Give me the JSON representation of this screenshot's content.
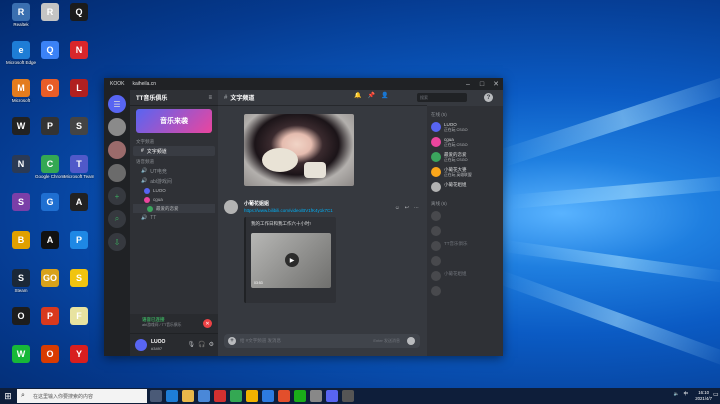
{
  "desktop": {
    "icons": [
      {
        "label": "Realtek",
        "col": 0,
        "row": 0,
        "color": "#3a6fb0",
        "glyph": "R"
      },
      {
        "label": "Microsoft Edge",
        "col": 0,
        "row": 1,
        "color": "#1e7dd6",
        "glyph": "e"
      },
      {
        "label": "Microsoft",
        "col": 0,
        "row": 2,
        "color": "#e37c1e",
        "glyph": "M"
      },
      {
        "label": "",
        "col": 0,
        "row": 3,
        "color": "#222",
        "glyph": "W"
      },
      {
        "label": "",
        "col": 0,
        "row": 4,
        "color": "#2b3a55",
        "glyph": "N"
      },
      {
        "label": "",
        "col": 0,
        "row": 5,
        "color": "#7a3fa8",
        "glyph": "S"
      },
      {
        "label": "",
        "col": 0,
        "row": 6,
        "color": "#e0a000",
        "glyph": "B"
      },
      {
        "label": "Steam",
        "col": 0,
        "row": 7,
        "color": "#1b2838",
        "glyph": "S"
      },
      {
        "label": "",
        "col": 0,
        "row": 8,
        "color": "#1d1d1d",
        "glyph": "O"
      },
      {
        "label": "",
        "col": 0,
        "row": 9,
        "color": "#17b838",
        "glyph": "W"
      },
      {
        "label": "",
        "col": 1,
        "row": 0,
        "color": "#c4c4c4",
        "glyph": "R"
      },
      {
        "label": "",
        "col": 1,
        "row": 1,
        "color": "#3b82f6",
        "glyph": "Q"
      },
      {
        "label": "",
        "col": 1,
        "row": 2,
        "color": "#e85d27",
        "glyph": "O"
      },
      {
        "label": "",
        "col": 1,
        "row": 3,
        "color": "#333",
        "glyph": "P"
      },
      {
        "label": "Google Chrome",
        "col": 1,
        "row": 4,
        "color": "#34a853",
        "glyph": "C"
      },
      {
        "label": "",
        "col": 1,
        "row": 5,
        "color": "#1f6fd1",
        "glyph": "G"
      },
      {
        "label": "",
        "col": 1,
        "row": 6,
        "color": "#111",
        "glyph": "A"
      },
      {
        "label": "",
        "col": 1,
        "row": 7,
        "color": "#d8a21b",
        "glyph": "GO"
      },
      {
        "label": "",
        "col": 1,
        "row": 8,
        "color": "#d9391e",
        "glyph": "P"
      },
      {
        "label": "",
        "col": 1,
        "row": 9,
        "color": "#d83b01",
        "glyph": "O"
      },
      {
        "label": "",
        "col": 2,
        "row": 0,
        "color": "#1b1b1b",
        "glyph": "Q"
      },
      {
        "label": "",
        "col": 2,
        "row": 1,
        "color": "#d8262b",
        "glyph": "N"
      },
      {
        "label": "",
        "col": 2,
        "row": 2,
        "color": "#b02020",
        "glyph": "L"
      },
      {
        "label": "",
        "col": 2,
        "row": 3,
        "color": "#444",
        "glyph": "S"
      },
      {
        "label": "Microsoft Teams",
        "col": 2,
        "row": 4,
        "color": "#5059c9",
        "glyph": "T"
      },
      {
        "label": "",
        "col": 2,
        "row": 5,
        "color": "#222",
        "glyph": "A"
      },
      {
        "label": "",
        "col": 2,
        "row": 6,
        "color": "#1e88e5",
        "glyph": "P"
      },
      {
        "label": "",
        "col": 2,
        "row": 7,
        "color": "#f1c40f",
        "glyph": "S"
      },
      {
        "label": "",
        "col": 2,
        "row": 8,
        "color": "#e8e3a0",
        "glyph": "F"
      },
      {
        "label": "",
        "col": 2,
        "row": 9,
        "color": "#d81e1e",
        "glyph": "Y"
      }
    ]
  },
  "window": {
    "title_left": "KOOK",
    "title_url": "kaiheila.cn",
    "min_icon": "–",
    "max_icon": "□",
    "close_icon": "✕"
  },
  "server": {
    "name": "TT音乐俱乐",
    "banner_text": "音乐来袭",
    "guild_add": "+",
    "guild_explore": "⌕",
    "guild_download": "⇩"
  },
  "channels": {
    "text_category": "文字频道",
    "text_channels": [
      "文字频道"
    ],
    "voice_category": "语音频道",
    "voice_channels": [
      "UT电竞",
      "abl游戏间",
      "TT"
    ],
    "voice_users": [
      "LUOO",
      "cgua",
      "最爱的恋爱"
    ]
  },
  "voice_panel": {
    "status": "语音已连接",
    "sub": "abl游戏间 / TT音乐俱乐",
    "disconnect_icon": "✕"
  },
  "user_panel": {
    "name": "LUOO",
    "tag": "#3497",
    "mic_icon": "🎙",
    "headset_icon": "🎧",
    "settings_icon": "⚙"
  },
  "chat": {
    "channel_name": "文字频道",
    "message": {
      "author": "小葡花姐姐",
      "time": "",
      "link": "https://www.bilibili.com/video/BV1fK4y1k7C1",
      "embed_title": "我的工作日和我工作六十小时!",
      "duration": "03:53"
    },
    "composer_placeholder": "给 #文字频道 发消息",
    "composer_hint": "Enter 发送消息",
    "search_placeholder": "搜索"
  },
  "members": {
    "online_title": "在线 (5)",
    "online": [
      {
        "name": "LUOO",
        "status": "正在玩 CSGO",
        "color": "#5865f2"
      },
      {
        "name": "cgua",
        "status": "正在玩 CSGO",
        "color": "#eb459e"
      },
      {
        "name": "最爱的恋爱",
        "status": "正在玩 CSGO",
        "color": "#3ba55d"
      },
      {
        "name": "小葡花大婆",
        "status": "正在玩 英雄联盟",
        "color": "#faa61a"
      },
      {
        "name": "小葡花姐姐",
        "status": "",
        "color": "#b3b3b3"
      }
    ],
    "offline_title": "离线 (6)",
    "offline": [
      {
        "name": "",
        "color": "#777"
      },
      {
        "name": "",
        "color": "#777"
      },
      {
        "name": "TT音乐俱乐",
        "color": "#777"
      },
      {
        "name": "",
        "color": "#777"
      },
      {
        "name": "小葡花姐姐",
        "color": "#777"
      },
      {
        "name": "",
        "color": "#777"
      }
    ]
  },
  "taskbar": {
    "search_placeholder": "在这里输入你要搜索的内容",
    "time": "16:10",
    "date": "2021/4/7",
    "start_icon": "⊞",
    "lang": "中"
  }
}
